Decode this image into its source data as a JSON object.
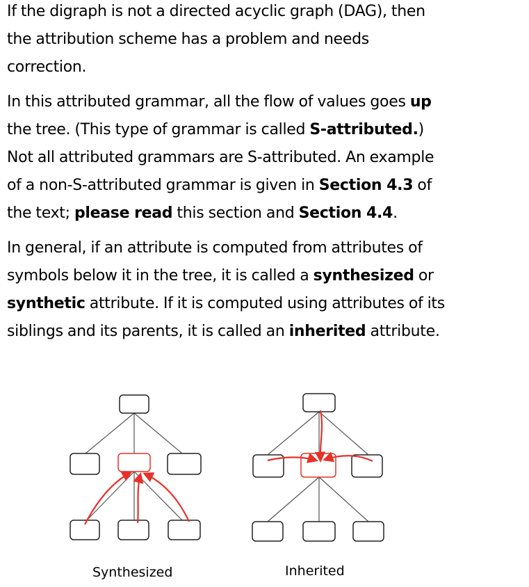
{
  "paragraphs": [
    {
      "lines": [
        [
          {
            "t": "If the digraph is not a directed acyclic graph (DAG), then"
          }
        ],
        [
          {
            "t": "the attribution scheme has a problem and needs"
          }
        ],
        [
          {
            "t": "correction."
          }
        ]
      ]
    },
    {
      "lines": [
        [
          {
            "t": "In this attributed grammar, all the flow of values goes "
          },
          {
            "t": "up",
            "b": true
          }
        ],
        [
          {
            "t": "the tree.  (This type of grammar is called "
          },
          {
            "t": "S-attributed.",
            "b": true
          },
          {
            "t": ")"
          }
        ],
        [
          {
            "t": "Not all attributed grammars are S-attributed.   An example"
          }
        ],
        [
          {
            "t": "of a non-S-attributed grammar is given in "
          },
          {
            "t": "Section 4.3",
            "b": true
          },
          {
            "t": " of"
          }
        ],
        [
          {
            "t": "the text; "
          },
          {
            "t": "please read",
            "b": true
          },
          {
            "t": " this section and "
          },
          {
            "t": "Section 4.4",
            "b": true
          },
          {
            "t": "."
          }
        ]
      ]
    },
    {
      "lines": [
        [
          {
            "t": "In general, if an attribute is computed from attributes of"
          }
        ],
        [
          {
            "t": "symbols below it in the tree, it is called a "
          },
          {
            "t": "synthesized",
            "b": true
          },
          {
            "t": " or"
          }
        ],
        [
          {
            "t": "synthetic",
            "b": true
          },
          {
            "t": " attribute.  If it is computed using attributes of its"
          }
        ],
        [
          {
            "t": "siblings and its parents, it is called an "
          },
          {
            "t": "inherited",
            "b": true
          },
          {
            "t": " attribute."
          }
        ]
      ]
    }
  ],
  "figure": {
    "captions": {
      "synthesized": "Synthesized",
      "inherited": "Inherited"
    },
    "colors": {
      "node_stroke": "#222222",
      "highlight": "#e8302a",
      "edge": "#555555"
    }
  }
}
